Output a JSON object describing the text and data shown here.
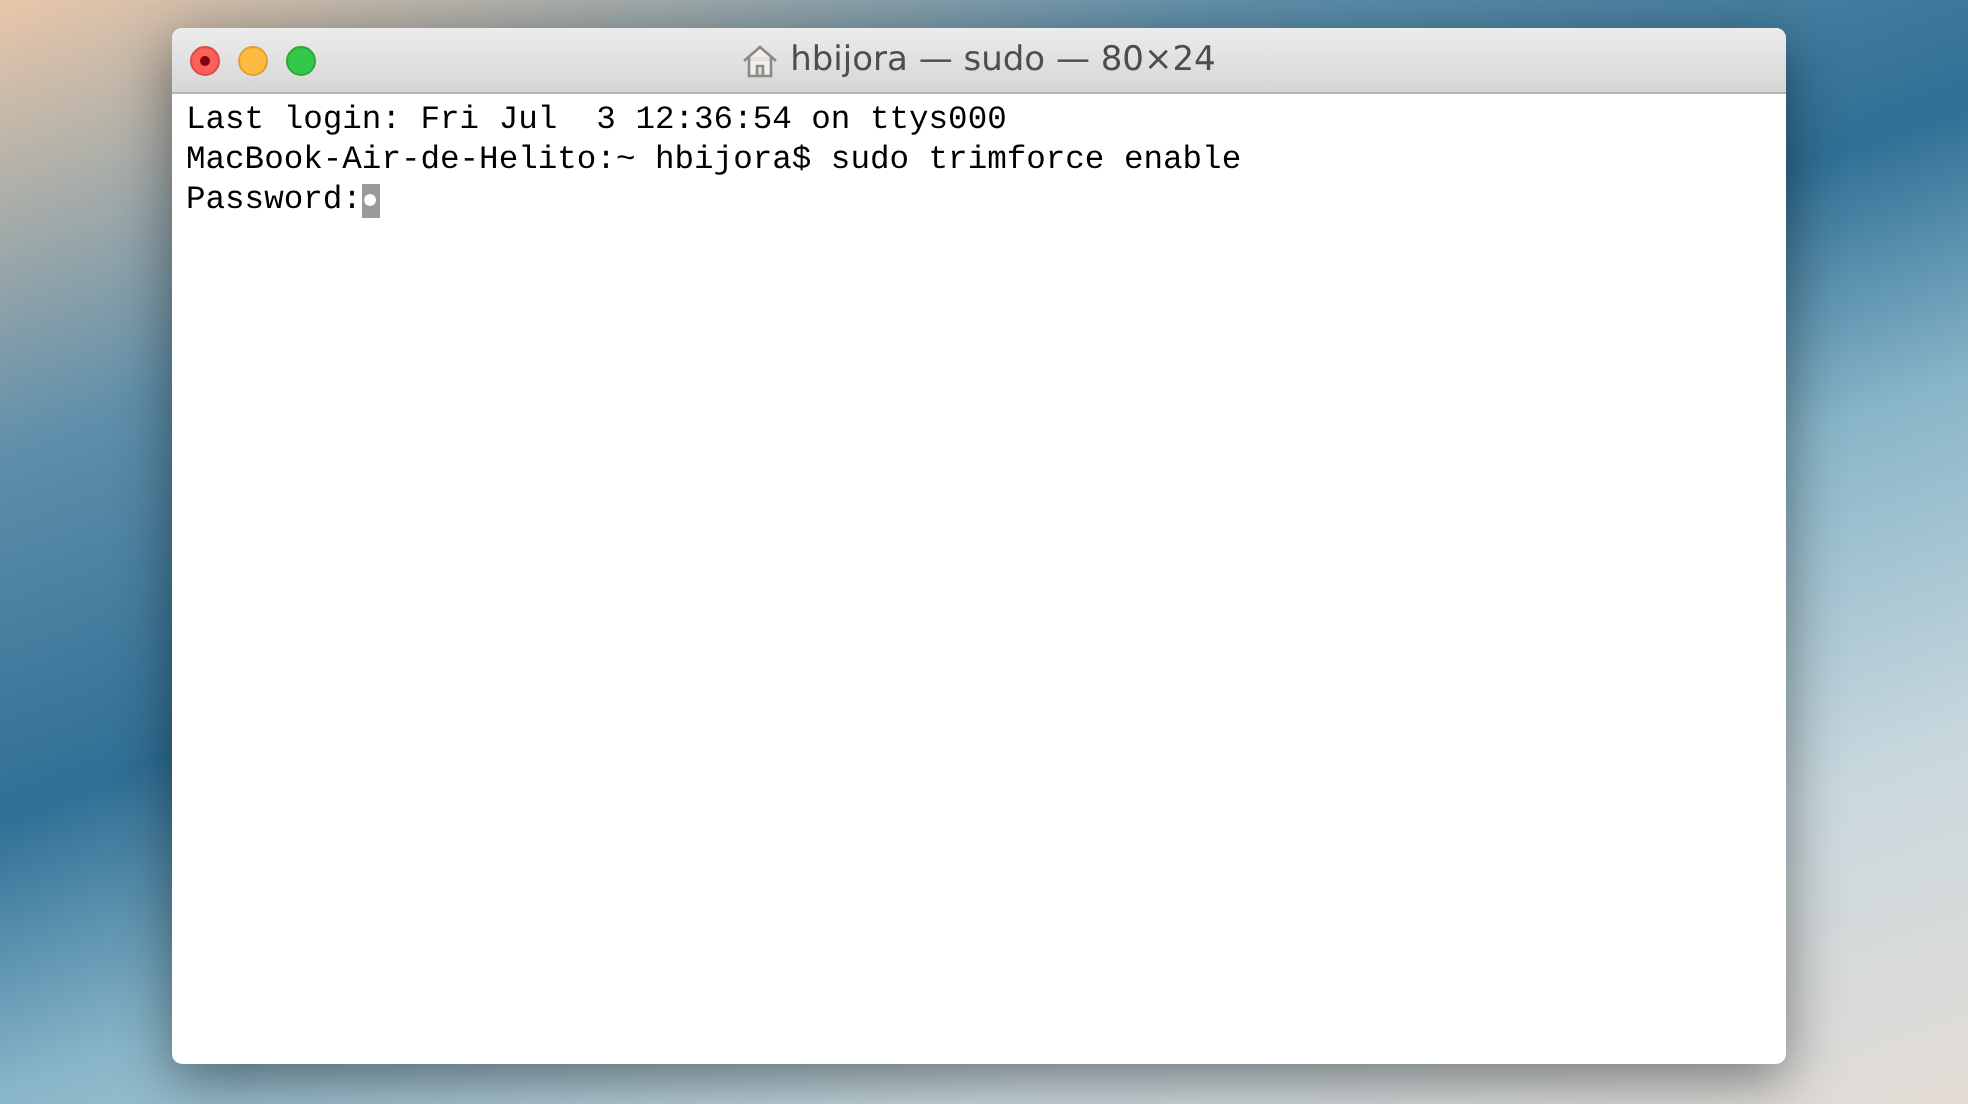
{
  "window": {
    "title": "hbijora — sudo — 80×24"
  },
  "terminal": {
    "lines": [
      "Last login: Fri Jul  3 12:36:54 on ttys000",
      "MacBook-Air-de-Helito:~ hbijora$ sudo trimforce enable",
      "Password:"
    ]
  }
}
